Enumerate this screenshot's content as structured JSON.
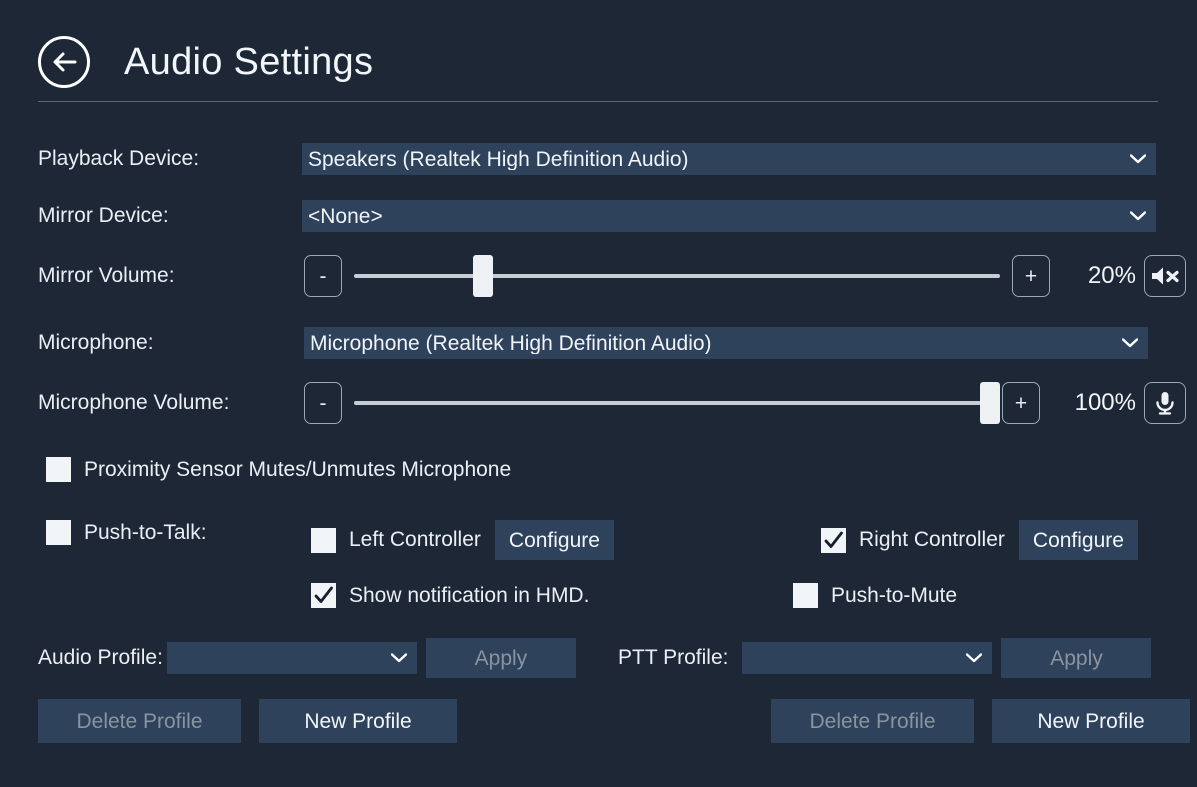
{
  "header": {
    "title": "Audio Settings",
    "back_icon": "arrow-left-circle-icon"
  },
  "theme": {
    "background": "#1d2735",
    "field_background": "#2e425c",
    "text": "#eaeff5",
    "disabled_text": "#8a94a0",
    "rule": "#5d6a79",
    "checkbox_fill": "#f2f5f8"
  },
  "playback_device": {
    "label": "Playback Device:",
    "value": "Speakers (Realtek High Definition Audio)",
    "chevron_icon": "chevron-down-icon"
  },
  "mirror_device": {
    "label": "Mirror Device:",
    "value": "<None>",
    "chevron_icon": "chevron-down-icon"
  },
  "mirror_volume": {
    "label": "Mirror Volume:",
    "minus_label": "-",
    "plus_label": "+",
    "value_percent": 20,
    "value_text": "20%",
    "mute_icon": "speaker-mute-icon",
    "muted": true
  },
  "microphone_device": {
    "label": "Microphone:",
    "value": "Microphone (Realtek High Definition Audio)",
    "chevron_icon": "chevron-down-icon"
  },
  "microphone_volume": {
    "label": "Microphone Volume:",
    "minus_label": "-",
    "plus_label": "+",
    "value_percent": 100,
    "value_text": "100%",
    "mic_icon": "microphone-icon",
    "muted": false
  },
  "proximity_sensor": {
    "label": "Proximity Sensor Mutes/Unmutes Microphone",
    "checked": false
  },
  "push_to_talk": {
    "label": "Push-to-Talk:",
    "checked": false
  },
  "left_controller": {
    "label": "Left Controller",
    "checked": false,
    "configure_label": "Configure"
  },
  "right_controller": {
    "label": "Right Controller",
    "checked": true,
    "configure_label": "Configure"
  },
  "show_notification": {
    "label": "Show notification in HMD.",
    "checked": true
  },
  "push_to_mute": {
    "label": "Push-to-Mute",
    "checked": false
  },
  "audio_profile": {
    "label": "Audio Profile:",
    "value": "",
    "chevron_icon": "chevron-down-icon",
    "apply_label": "Apply",
    "apply_disabled": true,
    "delete_label": "Delete Profile",
    "delete_disabled": true,
    "new_label": "New Profile",
    "new_disabled": false
  },
  "ptt_profile": {
    "label": "PTT Profile:",
    "value": "",
    "chevron_icon": "chevron-down-icon",
    "apply_label": "Apply",
    "apply_disabled": true,
    "delete_label": "Delete Profile",
    "delete_disabled": true,
    "new_label": "New Profile",
    "new_disabled": false
  }
}
